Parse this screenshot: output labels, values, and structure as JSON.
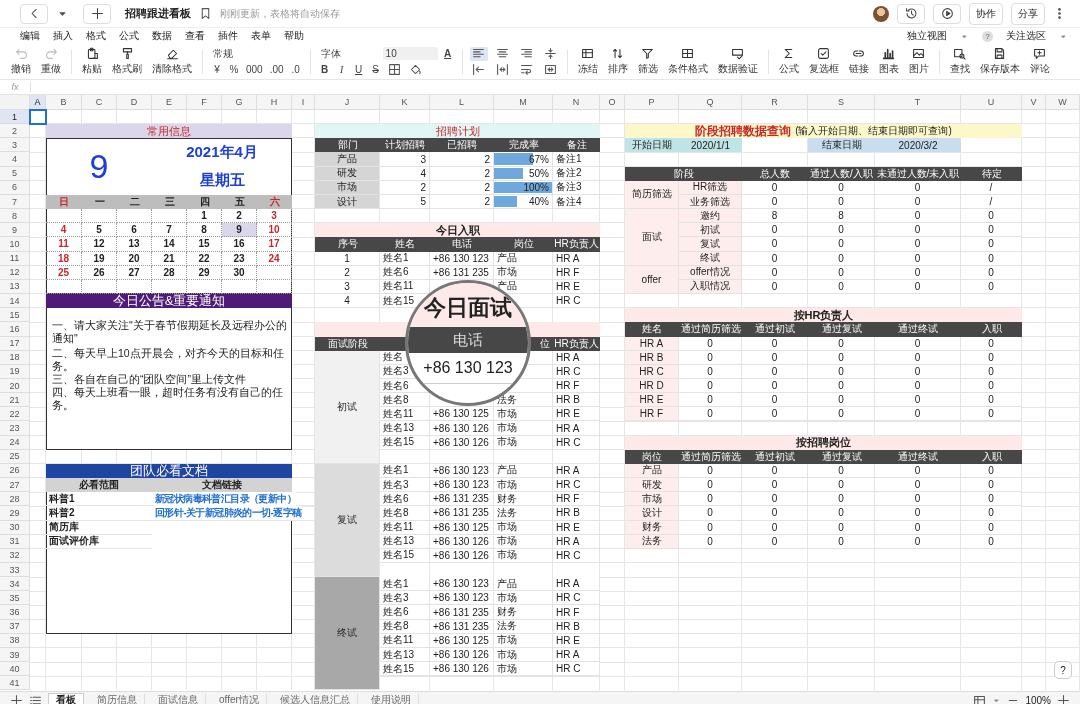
{
  "app_bar": {
    "title": "招聘跟进看板",
    "status": "刚刚更新，表格将自动保存",
    "actions": [
      "协作",
      "分享"
    ]
  },
  "menu": {
    "items": [
      "编辑",
      "插入",
      "格式",
      "公式",
      "数据",
      "查看",
      "插件",
      "表单",
      "帮助"
    ],
    "view": "独立视图",
    "help": "?",
    "focus": "关注选区"
  },
  "toolbar": {
    "history": [
      {
        "label": "撤销",
        "disabled": true
      },
      {
        "label": "重做",
        "disabled": true
      }
    ],
    "clipboard": [
      "粘贴",
      "格式刷",
      "清除格式"
    ],
    "number_format": {
      "value": "常规",
      "symbols": [
        "¥",
        "%",
        "000",
        ".00",
        ".0"
      ]
    },
    "font": {
      "family": "字体",
      "size": "10",
      "color_glyph": "A",
      "styles": [
        "B",
        "I",
        "U",
        "S"
      ]
    },
    "align": [
      {
        "selected": true
      },
      {
        "selected": false
      },
      {
        "selected": false
      },
      {
        "selected": false
      },
      {
        "selected": false
      },
      {
        "selected": false
      },
      {
        "selected": false
      },
      {
        "selected": false
      }
    ],
    "data_tools": [
      "冻结",
      "排序",
      "筛选",
      "条件格式",
      "数据验证"
    ],
    "insert_tools": [
      "公式",
      "复选框",
      "链接",
      "图表",
      "图片"
    ],
    "other_tools": [
      "查找",
      "保存版本",
      "评论"
    ]
  },
  "formula_bar": {
    "label": "fx"
  },
  "sheet": {
    "columns": [
      {
        "label": "A",
        "selected": true
      },
      {
        "label": "B",
        "selected": false
      },
      {
        "label": "C",
        "selected": false
      },
      {
        "label": "D",
        "selected": false
      },
      {
        "label": "E",
        "selected": false
      },
      {
        "label": "F",
        "selected": false
      },
      {
        "label": "G",
        "selected": false
      },
      {
        "label": "H",
        "selected": false
      },
      {
        "label": "I",
        "selected": false
      },
      {
        "label": "J",
        "selected": false
      },
      {
        "label": "K",
        "selected": false
      },
      {
        "label": "L",
        "selected": false
      },
      {
        "label": "M",
        "selected": false
      },
      {
        "label": "N",
        "selected": false
      },
      {
        "label": "O",
        "selected": false
      },
      {
        "label": "P",
        "selected": false
      },
      {
        "label": "Q",
        "selected": false
      },
      {
        "label": "R",
        "selected": false
      },
      {
        "label": "S",
        "selected": false
      },
      {
        "label": "T",
        "selected": false
      },
      {
        "label": "U",
        "selected": false
      },
      {
        "label": "V",
        "selected": false
      },
      {
        "label": "W",
        "selected": false
      }
    ],
    "rows": [
      {
        "label": "1",
        "selected": true
      },
      {
        "label": "2",
        "selected": false
      },
      {
        "label": "3",
        "selected": false
      },
      {
        "label": "4",
        "selected": false
      },
      {
        "label": "5",
        "selected": false
      },
      {
        "label": "6",
        "selected": false
      },
      {
        "label": "7",
        "selected": false
      },
      {
        "label": "8",
        "selected": false
      },
      {
        "label": "9",
        "selected": false
      },
      {
        "label": "10",
        "selected": false
      },
      {
        "label": "11",
        "selected": false
      },
      {
        "label": "12",
        "selected": false
      },
      {
        "label": "13",
        "selected": false
      },
      {
        "label": "14",
        "selected": false
      },
      {
        "label": "15",
        "selected": false
      },
      {
        "label": "16",
        "selected": false
      },
      {
        "label": "17",
        "selected": false
      },
      {
        "label": "18",
        "selected": false
      },
      {
        "label": "19",
        "selected": false
      },
      {
        "label": "20",
        "selected": false
      },
      {
        "label": "21",
        "selected": false
      },
      {
        "label": "22",
        "selected": false
      },
      {
        "label": "23",
        "selected": false
      },
      {
        "label": "24",
        "selected": false
      },
      {
        "label": "25",
        "selected": false
      },
      {
        "label": "26",
        "selected": false
      },
      {
        "label": "27",
        "selected": false
      },
      {
        "label": "28",
        "selected": false
      },
      {
        "label": "29",
        "selected": false
      },
      {
        "label": "30",
        "selected": false
      },
      {
        "label": "31",
        "selected": false
      },
      {
        "label": "32",
        "selected": false
      },
      {
        "label": "33",
        "selected": false
      },
      {
        "label": "34",
        "selected": false
      },
      {
        "label": "35",
        "selected": false
      },
      {
        "label": "36",
        "selected": false
      },
      {
        "label": "37",
        "selected": false
      },
      {
        "label": "38",
        "selected": false
      },
      {
        "label": "39",
        "selected": false
      },
      {
        "label": "40",
        "selected": false
      },
      {
        "label": "41",
        "selected": false
      }
    ]
  },
  "common_info": {
    "title": "常用信息",
    "day": "9",
    "month": "2021年4月",
    "weekday": "星期五",
    "weekdays": [
      {
        "label": "日",
        "weekend": true
      },
      {
        "label": "一",
        "weekend": false
      },
      {
        "label": "二",
        "weekend": false
      },
      {
        "label": "三",
        "weekend": false
      },
      {
        "label": "四",
        "weekend": false
      },
      {
        "label": "五",
        "weekend": false
      },
      {
        "label": "六",
        "weekend": true
      }
    ],
    "weeks": [
      [
        {
          "d": "1",
          "selected": false
        },
        {
          "d": "2",
          "selected": false
        },
        {
          "d": "3",
          "selected": false
        }
      ],
      [
        {
          "d": "4",
          "selected": false
        },
        {
          "d": "5",
          "selected": false
        },
        {
          "d": "6",
          "selected": false
        },
        {
          "d": "7",
          "selected": false
        },
        {
          "d": "8",
          "selected": false
        },
        {
          "d": "9",
          "selected": true
        },
        {
          "d": "10",
          "selected": false
        }
      ],
      [
        {
          "d": "11",
          "selected": false
        },
        {
          "d": "12",
          "selected": false
        },
        {
          "d": "13",
          "selected": false
        },
        {
          "d": "14",
          "selected": false
        },
        {
          "d": "15",
          "selected": false
        },
        {
          "d": "16",
          "selected": false
        },
        {
          "d": "17",
          "selected": false
        }
      ],
      [
        {
          "d": "18",
          "selected": false
        },
        {
          "d": "19",
          "selected": false
        },
        {
          "d": "20",
          "selected": false
        },
        {
          "d": "21",
          "selected": false
        },
        {
          "d": "22",
          "selected": false
        },
        {
          "d": "23",
          "selected": false
        },
        {
          "d": "24",
          "selected": false
        }
      ],
      [
        {
          "d": "25",
          "selected": false
        },
        {
          "d": "26",
          "selected": false
        },
        {
          "d": "27",
          "selected": false
        },
        {
          "d": "28",
          "selected": false
        },
        {
          "d": "29",
          "selected": false
        },
        {
          "d": "30",
          "selected": false
        }
      ]
    ]
  },
  "notice": {
    "title": "今日公告&重要通知",
    "lines": [
      "一、请大家关注\"关于春节假期延长及远程办公的通知\"",
      "二、每天早上10点开晨会，对齐今天的目标和任务。",
      "三、各自在自己的“团队空间”里上传文件",
      "四、每天上班看一眼，超时任务有没有自己的任务。"
    ]
  },
  "team_docs": {
    "title": "团队必看文档",
    "columns": [
      "必看范围",
      "文档链接"
    ],
    "rows": [
      {
        "scope": "科普1",
        "link": "新冠状病毒科普汇目录（更新中）"
      },
      {
        "scope": "科普2",
        "link": "回形针-关于新冠肺炎的一切-逐字稿"
      },
      {
        "scope": "简历库"
      },
      {
        "scope": "面试评价库"
      }
    ]
  },
  "recruit_plan": {
    "title": "招聘计划",
    "columns": [
      "部门",
      "计划招聘",
      "已招聘",
      "完成率",
      "备注"
    ],
    "rows": [
      {
        "dept": "产品",
        "planned": "3",
        "hired": "2",
        "rate": "67%",
        "level": 0.67,
        "note": "备注1"
      },
      {
        "dept": "研发",
        "planned": "4",
        "hired": "2",
        "rate": "50%",
        "level": 0.5,
        "note": "备注2"
      },
      {
        "dept": "市场",
        "planned": "2",
        "hired": "2",
        "rate": "100%",
        "level": 1,
        "note": "备注3"
      },
      {
        "dept": "设计",
        "planned": "5",
        "hired": "2",
        "rate": "40%",
        "level": 0.4,
        "note": "备注4"
      }
    ]
  },
  "today_onboard": {
    "title": "今日入职",
    "columns": [
      "序号",
      "姓名",
      "电话",
      "岗位",
      "HR负责人"
    ],
    "rows": [
      {
        "no": "1",
        "name": "姓名1",
        "phone": "+86 130 123",
        "post": "产品",
        "hr": "HR A"
      },
      {
        "no": "2",
        "name": "姓名6",
        "phone": "+86 131 235",
        "post": "市场",
        "hr": "HR F"
      },
      {
        "no": "3",
        "name": "姓名11",
        "post": "产品",
        "hr": "HR E"
      },
      {
        "no": "4",
        "name": "姓名15",
        "hr": "HR C"
      }
    ]
  },
  "today_interview": {
    "columns": [
      "面试阶段",
      "位",
      "HR负责人"
    ],
    "stages": [
      {
        "stage": "初试",
        "color": "#f1f1f1",
        "rows": [
          {
            "name": "姓名",
            "hr": "HR A"
          },
          {
            "name": "姓名3",
            "hr": "HR C"
          },
          {
            "name": "姓名6",
            "hr": "HR F"
          },
          {
            "name": "姓名8",
            "post": "法务",
            "hr": "HR B"
          },
          {
            "name": "姓名11",
            "phone": "+86 130 125",
            "post": "市场",
            "hr": "HR E"
          },
          {
            "name": "姓名13",
            "phone": "+86 130 126",
            "post": "市场",
            "hr": "HR A"
          },
          {
            "name": "姓名15",
            "phone": "+86 130 126",
            "post": "市场",
            "hr": "HR C"
          }
        ]
      },
      {
        "stage": "复试",
        "color": "#dcdcdc",
        "rows": [
          {
            "name": "姓名1",
            "phone": "+86 130 123",
            "post": "产品",
            "hr": "HR A"
          },
          {
            "name": "姓名3",
            "phone": "+86 130 123",
            "post": "市场",
            "hr": "HR C"
          },
          {
            "name": "姓名6",
            "phone": "+86 131 235",
            "post": "财务",
            "hr": "HR F"
          },
          {
            "name": "姓名8",
            "phone": "+86 131 235",
            "post": "法务",
            "hr": "HR B"
          },
          {
            "name": "姓名11",
            "phone": "+86 130 125",
            "post": "市场",
            "hr": "HR E"
          },
          {
            "name": "姓名13",
            "phone": "+86 130 126",
            "post": "市场",
            "hr": "HR A"
          },
          {
            "name": "姓名15",
            "phone": "+86 130 126",
            "post": "市场",
            "hr": "HR C"
          }
        ]
      },
      {
        "stage": "终试",
        "color": "#a8a8a8",
        "rows": [
          {
            "name": "姓名1",
            "phone": "+86 130 123",
            "post": "产品",
            "hr": "HR A"
          },
          {
            "name": "姓名3",
            "phone": "+86 130 123",
            "post": "市场",
            "hr": "HR C"
          },
          {
            "name": "姓名6",
            "phone": "+86 131 235",
            "post": "财务",
            "hr": "HR F"
          },
          {
            "name": "姓名8",
            "phone": "+86 131 235",
            "post": "法务",
            "hr": "HR B"
          },
          {
            "name": "姓名11",
            "phone": "+86 130 125",
            "post": "市场",
            "hr": "HR E"
          },
          {
            "name": "姓名13",
            "phone": "+86 130 126",
            "post": "市场",
            "hr": "HR A"
          },
          {
            "name": "姓名15",
            "phone": "+86 130 126",
            "post": "市场",
            "hr": "HR C"
          }
        ]
      }
    ]
  },
  "magnifier": {
    "title": "今日面试",
    "column": "电话",
    "value": "+86 130 123"
  },
  "stage_query": {
    "title": "阶段招聘数据查询",
    "hint": "(输入开始日期、结束日期即可查询)",
    "start_label": "开始日期",
    "start": "2020/1/1",
    "end_label": "结束日期",
    "end": "2020/3/2",
    "columns": [
      "阶段",
      "总人数",
      "通过人数/入职",
      "未通过人数/未入职",
      "待定"
    ],
    "groups": [
      {
        "name": "简历筛选",
        "rows": [
          {
            "step": "HR筛选",
            "values": [
              "0",
              "0",
              "0",
              "/"
            ]
          },
          {
            "step": "业务筛选",
            "values": [
              "0",
              "0",
              "0",
              "/"
            ]
          }
        ]
      },
      {
        "name": "面试",
        "rows": [
          {
            "step": "邀约",
            "values": [
              "8",
              "8",
              "0",
              "0"
            ]
          },
          {
            "step": "初试",
            "values": [
              "0",
              "0",
              "0",
              "0"
            ]
          },
          {
            "step": "复试",
            "values": [
              "0",
              "0",
              "0",
              "0"
            ]
          },
          {
            "step": "终试",
            "values": [
              "0",
              "0",
              "0",
              "0"
            ]
          }
        ]
      },
      {
        "name": "offer",
        "rows": [
          {
            "step": "offer情况",
            "values": [
              "0",
              "0",
              "0",
              "0"
            ]
          },
          {
            "step": "入职情况",
            "values": [
              "0",
              "0",
              "0",
              "0"
            ]
          }
        ]
      }
    ]
  },
  "by_hr": {
    "title": "按HR负责人",
    "columns": [
      "姓名",
      "通过简历筛选",
      "通过初试",
      "通过复试",
      "通过终试",
      "入职"
    ],
    "rows": [
      [
        "HR A",
        "0",
        "0",
        "0",
        "0",
        "0"
      ],
      [
        "HR B",
        "0",
        "0",
        "0",
        "0",
        "0"
      ],
      [
        "HR C",
        "0",
        "0",
        "0",
        "0",
        "0"
      ],
      [
        "HR D",
        "0",
        "0",
        "0",
        "0",
        "0"
      ],
      [
        "HR E",
        "0",
        "0",
        "0",
        "0",
        "0"
      ],
      [
        "HR F",
        "0",
        "0",
        "0",
        "0",
        "0"
      ]
    ]
  },
  "by_post": {
    "title": "按招聘岗位",
    "columns": [
      "岗位",
      "通过简历筛选",
      "通过初试",
      "通过复试",
      "通过终试",
      "入职"
    ],
    "rows": [
      [
        "产品",
        "0",
        "0",
        "0",
        "0",
        "0"
      ],
      [
        "研发",
        "0",
        "0",
        "0",
        "0",
        "0"
      ],
      [
        "市场",
        "0",
        "0",
        "0",
        "0",
        "0"
      ],
      [
        "设计",
        "0",
        "0",
        "0",
        "0",
        "0"
      ],
      [
        "财务",
        "0",
        "0",
        "0",
        "0",
        "0"
      ],
      [
        "法务",
        "0",
        "0",
        "0",
        "0",
        "0"
      ]
    ]
  },
  "sheet_tabs": [
    {
      "label": "看板",
      "selected": true
    },
    {
      "label": "简历信息",
      "selected": false
    },
    {
      "label": "面试信息",
      "selected": false
    },
    {
      "label": "offer情况",
      "selected": false
    },
    {
      "label": "候选人信息汇总",
      "selected": false
    },
    {
      "label": "使用说明",
      "selected": false
    }
  ],
  "zoom": "100%",
  "help": "?"
}
